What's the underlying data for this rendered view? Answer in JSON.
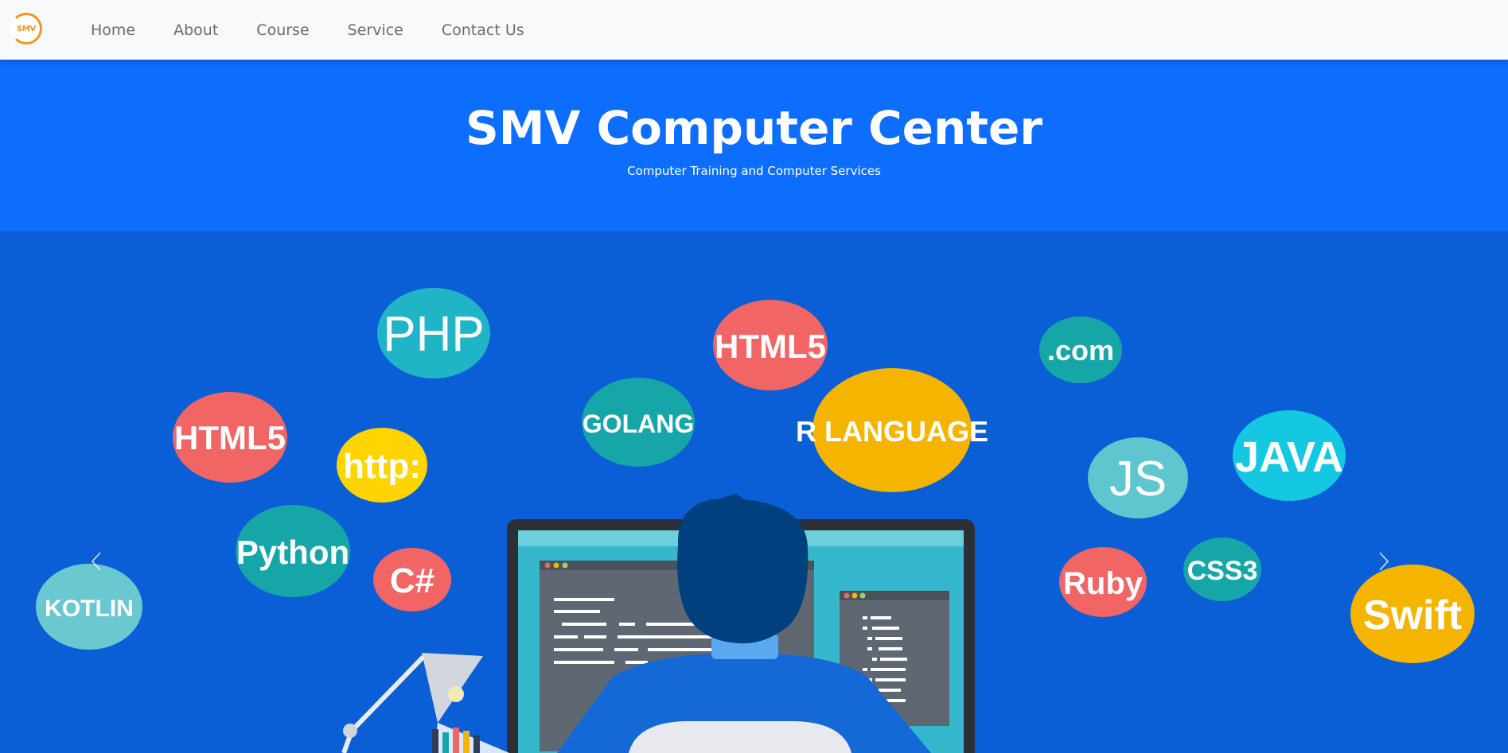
{
  "brand": {
    "logo_text": "SMV"
  },
  "nav": {
    "items": [
      {
        "label": "Home"
      },
      {
        "label": "About"
      },
      {
        "label": "Course"
      },
      {
        "label": "Service"
      },
      {
        "label": "Contact Us"
      }
    ]
  },
  "hero": {
    "title": "SMV Computer Center",
    "subtitle": "Computer Training and Computer Services"
  },
  "carousel": {
    "bubbles": [
      {
        "text": "PHP",
        "color": "#1fb5c6"
      },
      {
        "text": "HTML5",
        "color": "#f16565"
      },
      {
        "text": ".com",
        "color": "#16a6a8"
      },
      {
        "text": "HTML5",
        "color": "#f16565"
      },
      {
        "text": "http:",
        "color": "#ffd400"
      },
      {
        "text": "GOLANG",
        "color": "#16a6a8"
      },
      {
        "text": "R LANGUAGE",
        "color": "#f5b400"
      },
      {
        "text": "JS",
        "color": "#5fc5cf"
      },
      {
        "text": "JAVA",
        "color": "#14c8e2"
      },
      {
        "text": "Python",
        "color": "#16a6a8"
      },
      {
        "text": "C#",
        "color": "#f16565"
      },
      {
        "text": "Ruby",
        "color": "#f16565"
      },
      {
        "text": "CSS3",
        "color": "#16a6a8"
      },
      {
        "text": "Swift",
        "color": "#f5b400"
      },
      {
        "text": "KOTLIN",
        "color": "#6ac9d0"
      }
    ],
    "prev_icon": "chevron-left-icon",
    "next_icon": "chevron-right-icon"
  },
  "colors": {
    "navbar_bg": "#f8f9fa",
    "hero_bg": "#0d6efd",
    "carousel_bg": "#0b5fd6",
    "logo_accent": "#f7941d"
  }
}
